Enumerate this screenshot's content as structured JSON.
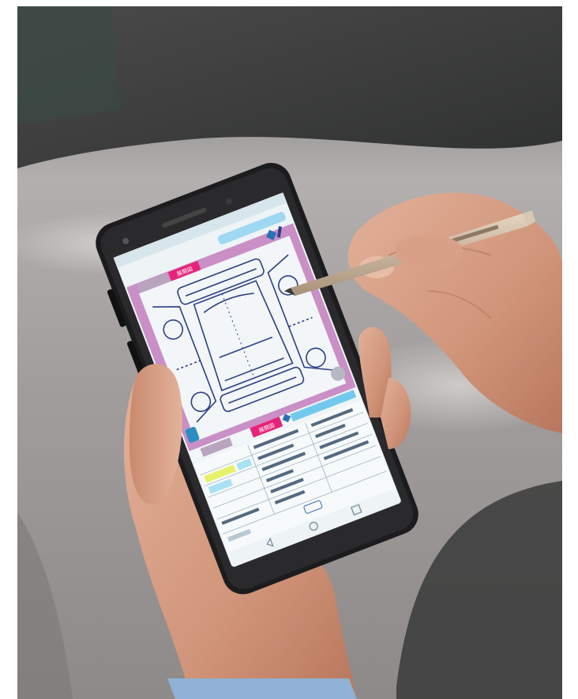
{
  "scene": {
    "screen": {
      "top_buttons": {
        "left_tab": "",
        "active_tab": "展開図"
      },
      "bottom_buttons": {
        "active_tab": "展開図"
      }
    }
  },
  "colors": {
    "background_car": "#9a9695",
    "phone_case": "#1c1c1e",
    "screen_bg": "#eef4f6",
    "screen_frame": "#c98fc6",
    "accent_magenta": "#e6237a",
    "accent_cyan": "#72c9ee",
    "diagram_lines": "#2c3f86",
    "stylus": "#c8b6a0",
    "skin": "#d49a7f"
  }
}
